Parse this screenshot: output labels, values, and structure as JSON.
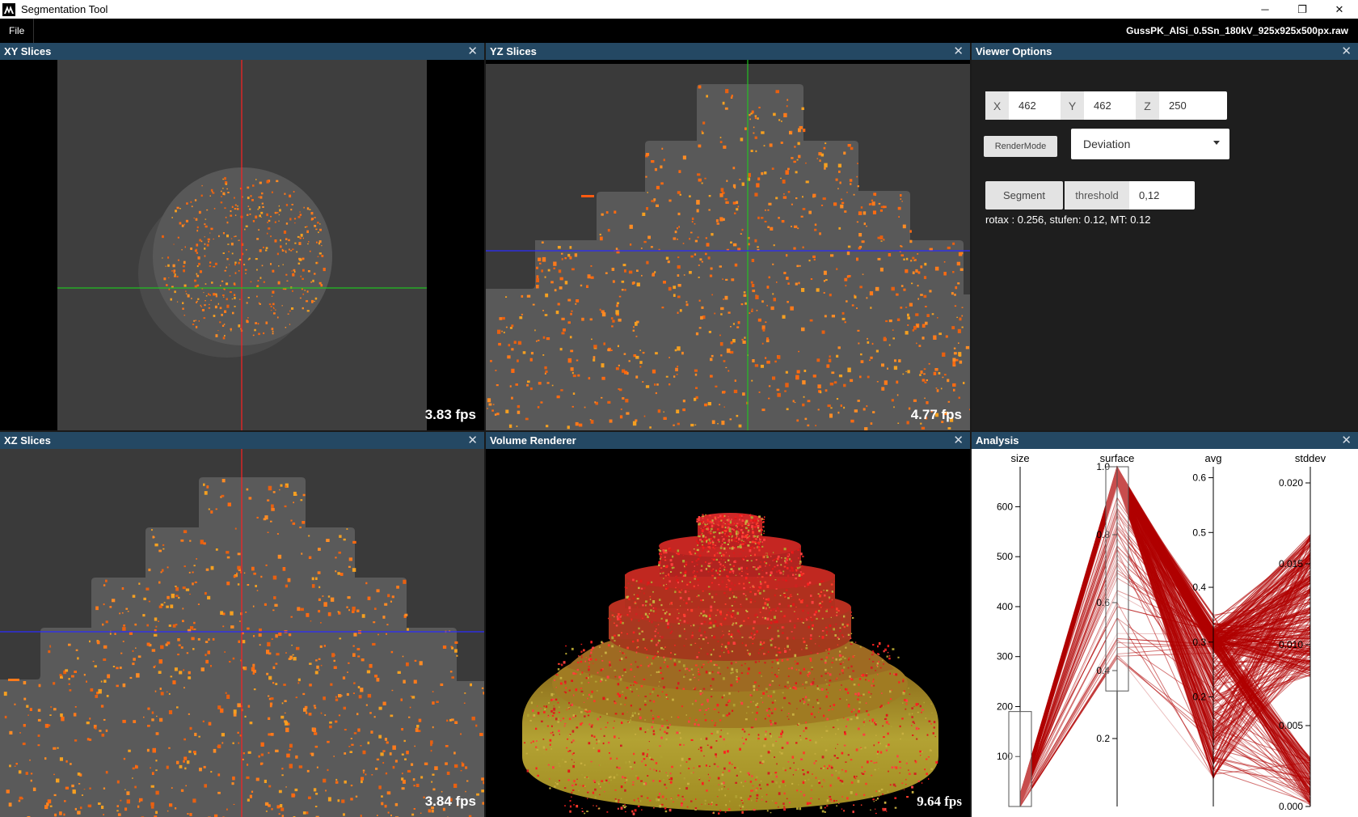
{
  "window": {
    "title": "Segmentation Tool",
    "minimize": "─",
    "restore": "❐",
    "close": "✕"
  },
  "menu": {
    "file": "File",
    "filename": "GussPK_AlSi_0.5Sn_180kV_925x925x500px.raw"
  },
  "panels": {
    "xy": {
      "title": "XY Slices",
      "fps": "3.83 fps",
      "close": "✕"
    },
    "yz": {
      "title": "YZ Slices",
      "fps": "4.77 fps",
      "close": "✕"
    },
    "xz": {
      "title": "XZ Slices",
      "fps": "3.84 fps",
      "close": "✕"
    },
    "volume": {
      "title": "Volume Renderer",
      "fps": "9.64 fps",
      "close": "✕"
    },
    "options": {
      "title": "Viewer Options",
      "close": "✕"
    },
    "analysis": {
      "title": "Analysis",
      "close": "✕"
    }
  },
  "viewer_options": {
    "x_label": "X",
    "x_value": "462",
    "y_label": "Y",
    "y_value": "462",
    "z_label": "Z",
    "z_value": "250",
    "rendermode_button": "RenderMode",
    "rendermode_value": "Deviation",
    "segment_button": "Segment",
    "threshold_label": "threshold",
    "threshold_value": "0,12",
    "info": "rotax : 0.256, stufen: 0.12, MT: 0.12"
  },
  "colors": {
    "header": "#244863",
    "pore": "#ff7a1a",
    "line_red": "#ff2020",
    "line_green": "#22c022",
    "line_blue": "#2a2aff",
    "pc_line": "#b00000"
  },
  "chart_data": {
    "type": "parallel_coordinates",
    "axes": [
      {
        "name": "size",
        "min": 0,
        "max": 680,
        "ticks": [
          "100",
          "200",
          "300",
          "400",
          "500",
          "600"
        ],
        "brush": [
          0,
          190
        ]
      },
      {
        "name": "surface",
        "min": 0,
        "max": 1.0,
        "ticks": [
          "0.2",
          "0.4",
          "0.6",
          "0.8",
          "1.0"
        ],
        "brush": [
          0.34,
          1.0
        ]
      },
      {
        "name": "avg",
        "min": 0,
        "max": 0.62,
        "ticks": [
          "0.2",
          "0.3",
          "0.4",
          "0.5",
          "0.6"
        ]
      },
      {
        "name": "stddev",
        "min": 0,
        "max": 0.021,
        "ticks": [
          "0.000",
          "0.005",
          "0.010",
          "0.015",
          "0.020"
        ]
      }
    ]
  }
}
